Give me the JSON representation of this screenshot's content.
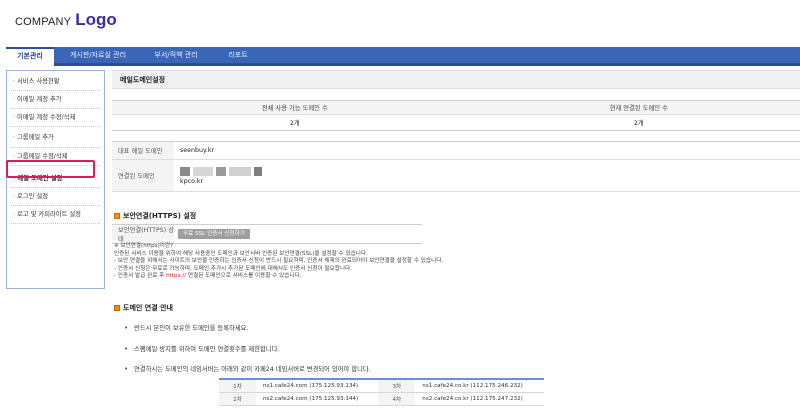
{
  "brand": {
    "company": "COMPANY",
    "logo": "Logo"
  },
  "tabs": [
    {
      "label": "기본관리",
      "active": true
    },
    {
      "label": "게시판/자료실 관리"
    },
    {
      "label": "부서/직책 관리"
    },
    {
      "label": "리포트"
    }
  ],
  "sidebar": {
    "items": [
      {
        "label": "서비스 사용현황"
      },
      {
        "label": "이메일 계정 추가"
      },
      {
        "label": "이메일 계정 수정/삭제"
      },
      {
        "label": "그룹메일 추가"
      },
      {
        "label": "그룹메일 수정/삭제"
      },
      {
        "label": "메일 도메인 설정",
        "active": true
      },
      {
        "label": "로그인 설정"
      },
      {
        "label": "로고 및 카피라이트 설정"
      }
    ]
  },
  "page_title": "메일도메인설정",
  "stats": {
    "headers": [
      "전체 사용 가능 도메인 수",
      "현재 연결된 도메인 수"
    ],
    "values": [
      "2개",
      "2개"
    ]
  },
  "domains": {
    "primary_label": "대표 메일 도메인",
    "primary_value": "seenbuy.kr",
    "connected_label": "연결된 도메인",
    "connected_value": "kpco.kr"
  },
  "https": {
    "title": "보안연결(HTTPS) 설정",
    "state_label": "보안연결(HTTPS) 상태",
    "button": "무료 SSL 인증서 신청하기"
  },
  "https_notes": {
    "heading": "※ 보안연결(https)이란?",
    "line1": "인증된 서비스 이용을 위하여 해당 사용중인 도메인과 보안서버 인증된 보안연결(SSL)을 설정할 수 있습니다.",
    "line2": "- 보안 연결을 위해서는 사이트의 보안을 인증하는 인증서 신청이 반드시 필요하며, 인증서 체제의 완료되어야 보안연결을 설정할 수 있습니다.",
    "line3": "- 인증서 신청은 무료로 가능하며, 도메인 추가시 추가된 도메인에 대해서도 인증서 신청이 필요합니다.",
    "line4_before": "- 인증서 발급 완료 후 ",
    "line4_link": "https://",
    "line4_after": " 연결된 도메인으로 서비스를 이용할 수 있습니다."
  },
  "guide": {
    "title": "도메인 연결 안내",
    "items": [
      "반드시 본인이 보유한 도메인을 등록하세요.",
      "스팸메일 방지를 위하여 도메인 연결횟수를 제한합니다.",
      "연결하시는 도메인의 네임서버는 아래와 같이 카페24 네임서버로 변경되어 있어야 합니다."
    ]
  },
  "nameservers": [
    [
      "1차",
      "ns1.cafe24.com (175.125.93.134)",
      "3차",
      "ns1.cafe24.co.kr (112.175.246.232)"
    ],
    [
      "2차",
      "ns2.cafe24.com (175.125.93.144)",
      "4차",
      "ns2.cafe24.co.kr (112.175.247.232)"
    ]
  ],
  "colors": {
    "nav_bg": "#3a66b9",
    "brand_logo": "#3d2aa8",
    "highlight_box": "#e2185c",
    "section_marker": "#f0900a",
    "https_link": "#e02020"
  }
}
